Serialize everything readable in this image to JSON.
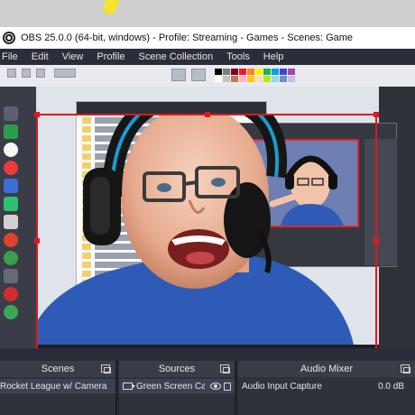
{
  "window": {
    "title": "OBS 25.0.0 (64-bit, windows) - Profile: Streaming - Games - Scenes: Game"
  },
  "menu": [
    "File",
    "Edit",
    "View",
    "Profile",
    "Scene Collection",
    "Tools",
    "Help"
  ],
  "docks": {
    "scenes": {
      "title": "Scenes",
      "item": "Rocket League w/ Camera"
    },
    "sources": {
      "title": "Sources",
      "item": "Green Screen Ca"
    },
    "mixer": {
      "title": "Audio Mixer",
      "channel": "Audio Input Capture",
      "level": "0.0 dB"
    }
  },
  "colors": {
    "selection": "#e1171e",
    "obs_background": "#2b2e38",
    "shirt": "#2f5bb8"
  }
}
